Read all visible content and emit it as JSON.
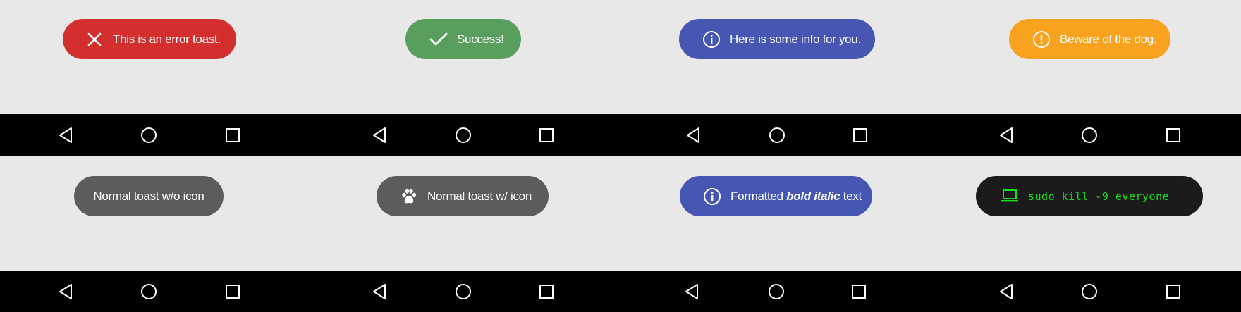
{
  "colors": {
    "background": "#e8e8e8",
    "navbar": "#000000",
    "error": "#d32f2f",
    "success": "#5a9e5e",
    "info": "#4656b2",
    "warning": "#f9a21f",
    "normal": "#5c5c5c",
    "hacker_bg": "#1b1b1b",
    "hacker_text": "#16e116"
  },
  "toasts": {
    "error": {
      "icon": "close-icon",
      "text": "This is an error toast."
    },
    "success": {
      "icon": "checkmark-icon",
      "text": "Success!"
    },
    "info": {
      "icon": "info-icon",
      "text": "Here is some info for you."
    },
    "warning": {
      "icon": "exclamation-icon",
      "text": "Beware of the dog."
    },
    "normal_no_icon": {
      "text": "Normal toast w/o icon"
    },
    "normal_icon": {
      "icon": "paw-icon",
      "text": "Normal toast w/ icon"
    },
    "formatted": {
      "icon": "info-icon",
      "prefix": "Formatted",
      "bold_italic": "bold italic",
      "suffix": "text"
    },
    "hacker": {
      "icon": "laptop-icon",
      "text": "sudo kill -9 everyone"
    }
  },
  "navbar": {
    "buttons": [
      "back-triangle-icon",
      "home-circle-icon",
      "recents-square-icon"
    ]
  }
}
